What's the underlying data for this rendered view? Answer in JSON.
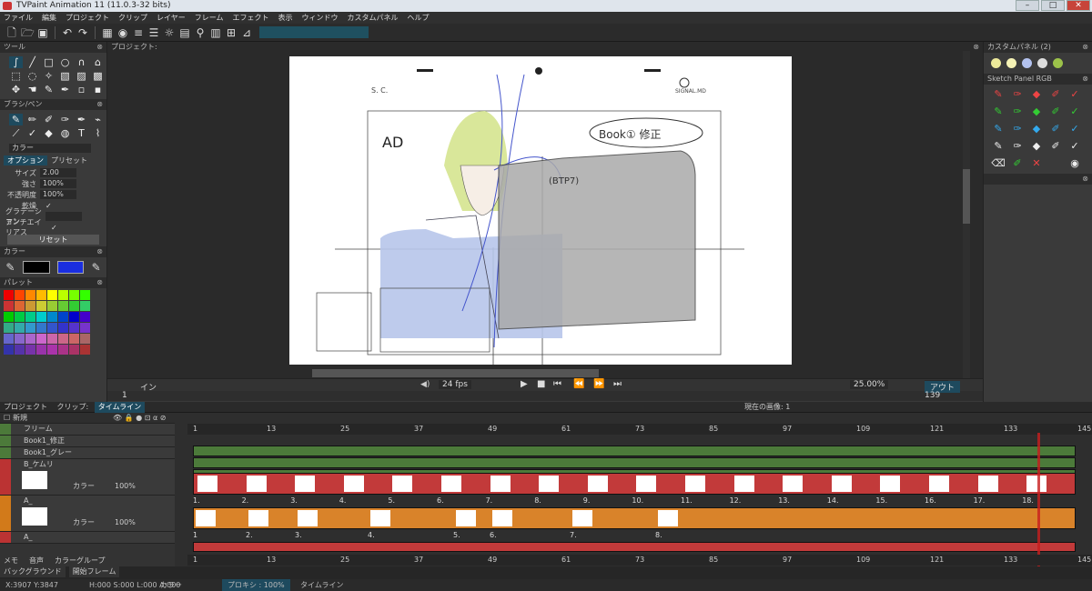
{
  "window": {
    "title": "TVPaint Animation 11 (11.0.3-32 bits)"
  },
  "menu": [
    "ファイル",
    "編集",
    "プロジェクト",
    "クリップ",
    "レイヤー",
    "フレーム",
    "エフェクト",
    "表示",
    "ウィンドウ",
    "カスタムパネル",
    "ヘルプ"
  ],
  "left": {
    "tools_title": "ツール",
    "brush_title": "ブラシ/ペン",
    "color_mode": "カラー",
    "tabs": [
      "オプション",
      "プリセット"
    ],
    "size_label": "サイズ",
    "size_val": "2.00",
    "strength_label": "強さ",
    "strength_val": "100%",
    "opacity_label": "不透明度",
    "opacity_val": "100%",
    "dry_label": "乾燥",
    "grad_label": "グラデーション",
    "aa_label": "アンチエイリアス",
    "reset_label": "リセット",
    "color_title": "カラー",
    "palette_title": "パレット",
    "colors": {
      "primary": "#000000",
      "secondary": "#1a2ee0"
    }
  },
  "right": {
    "custom_title": "カスタムパネル (2)",
    "sketch_title": "Sketch Panel RGB"
  },
  "playback": {
    "in_label": "イン",
    "fps": "24 fps",
    "zoom": "25.00%",
    "view_label": "表示",
    "out_label": "アウト",
    "in_frame": "1",
    "out_frame": "139"
  },
  "timeline": {
    "tabs": [
      "プロジェクト",
      "クリップ:",
      "タイムライン"
    ],
    "current_label": "現在の画像: 1",
    "new_label": "新規",
    "layers": [
      {
        "name": "フリーム"
      },
      {
        "name": "Book1_修正"
      },
      {
        "name": "Book1_グレー"
      },
      {
        "name": "B_ケムリ",
        "mode": "カラー",
        "opacity": "100%"
      },
      {
        "name": "A_",
        "mode": "カラー",
        "opacity": "100%"
      },
      {
        "name": "A_"
      }
    ],
    "ruler": [
      "1",
      "13",
      "25",
      "37",
      "49",
      "61",
      "73",
      "85",
      "97",
      "109",
      "121",
      "133",
      "145"
    ],
    "b_cells": [
      "1.",
      "2.",
      "3.",
      "4.",
      "5.",
      "6.",
      "7.",
      "8.",
      "9.",
      "10.",
      "11.",
      "12.",
      "13.",
      "14.",
      "15.",
      "16.",
      "17.",
      "18."
    ],
    "a_cells": [
      "1",
      "2.",
      "3.",
      "4.",
      "5.",
      "6.",
      "7.",
      "8."
    ]
  },
  "bottom": {
    "tabs": [
      "メモ",
      "音声",
      "カラーグループ"
    ],
    "bg_label": "バックグラウンド",
    "start_label": "開始フレーム",
    "coords": "X:3907  Y:3847",
    "hsl": "H:000 S:000 L:000 A:000",
    "color_label": "カラー",
    "proxy": "プロキシ : 100%",
    "tl_label": "タイムライン"
  },
  "canvas": {
    "sc": "S.     C.",
    "book": "Book① 修正",
    "cap": "(BTP7)",
    "ad": "AD",
    "brand": "SIGNAL.MD"
  }
}
